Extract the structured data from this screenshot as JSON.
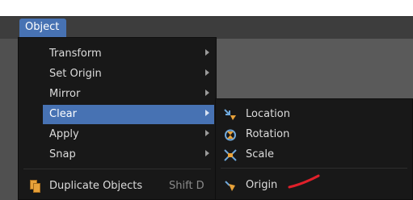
{
  "header": {
    "object_menu_label": "Object"
  },
  "menu": {
    "items": [
      {
        "label": "Transform",
        "has_submenu": true
      },
      {
        "label": "Set Origin",
        "has_submenu": true
      },
      {
        "label": "Mirror",
        "has_submenu": true
      },
      {
        "label": "Clear",
        "has_submenu": true,
        "highlighted": true
      },
      {
        "label": "Apply",
        "has_submenu": true
      },
      {
        "label": "Snap",
        "has_submenu": true
      }
    ],
    "duplicate": {
      "label": "Duplicate Objects",
      "shortcut": "Shift D",
      "icon": "duplicate-icon"
    }
  },
  "submenu": {
    "items": [
      {
        "label": "Location",
        "icon": "clear-location-icon"
      },
      {
        "label": "Rotation",
        "icon": "clear-rotation-icon"
      },
      {
        "label": "Scale",
        "icon": "clear-scale-icon"
      },
      {
        "label": "Origin",
        "icon": "clear-origin-icon"
      }
    ]
  },
  "colors": {
    "accent": "#4772b3",
    "menu_bg": "#181818",
    "icon_orange": "#e8a23a",
    "icon_blue": "#6fa8dc",
    "annotation_red": "#e0202a"
  }
}
